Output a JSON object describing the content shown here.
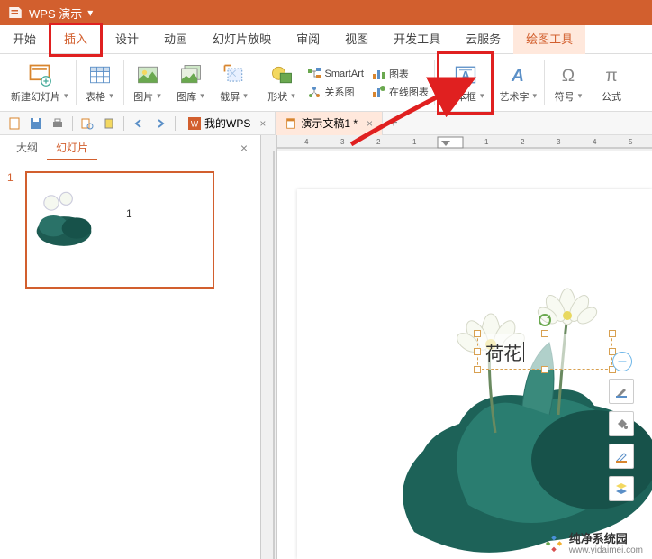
{
  "titlebar": {
    "app_name": "WPS 演示"
  },
  "menu": {
    "items": [
      "开始",
      "插入",
      "设计",
      "动画",
      "幻灯片放映",
      "审阅",
      "视图",
      "开发工具",
      "云服务",
      "绘图工具"
    ],
    "active_index": 1,
    "highlight_index": 1
  },
  "ribbon": {
    "new_slide": "新建幻灯片",
    "table": "表格",
    "picture": "图片",
    "gallery": "图库",
    "screenshot": "截屏",
    "shape": "形状",
    "smartart": "SmartArt",
    "chart": "图表",
    "relation": "关系图",
    "online_chart": "在线图表",
    "textbox": "文本框",
    "wordart": "艺术字",
    "symbol": "符号",
    "equation": "公式"
  },
  "tabs": {
    "wps_tab": "我的WPS",
    "doc_tab": "演示文稿1 *"
  },
  "left_panel": {
    "outline": "大纲",
    "slides": "幻灯片",
    "thumb_number": "1",
    "thumb_text": "1"
  },
  "canvas": {
    "textbox_content": "荷花",
    "ruler_labels": [
      "4",
      "3",
      "2",
      "1",
      "1",
      "2",
      "3",
      "4",
      "5"
    ]
  },
  "watermark": {
    "title": "纯净系统园",
    "url": "www.yidaimei.com"
  }
}
